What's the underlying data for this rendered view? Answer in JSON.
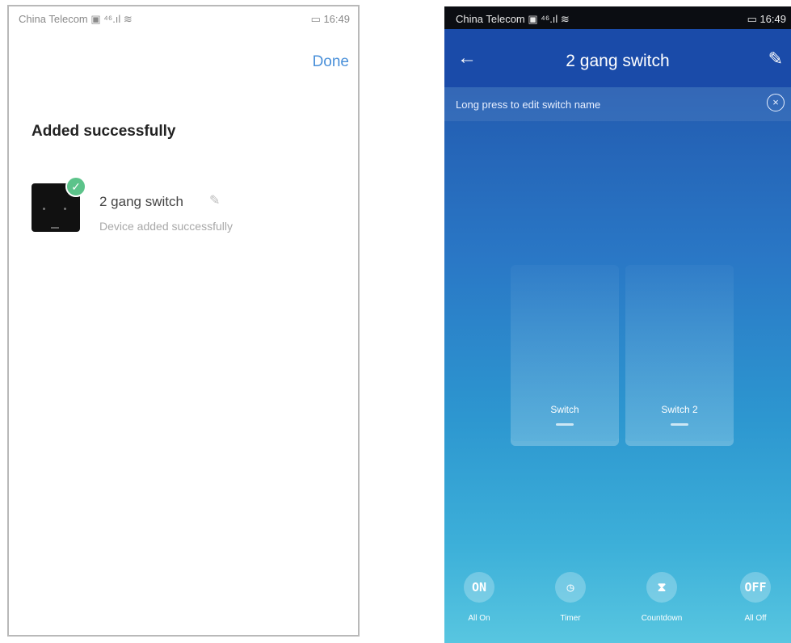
{
  "left": {
    "status": {
      "carrier": "China Telecom ▣ ⁴⁶.ıl ≋",
      "right": "▭ 16:49"
    },
    "done_label": "Done",
    "title": "Added successfully",
    "device": {
      "name": "2 gang switch",
      "status": "Device added successfully"
    }
  },
  "right": {
    "status": {
      "carrier": "China Telecom ▣ ⁴⁶.ıl ≋",
      "right": "▭ 16:49"
    },
    "title": "2 gang switch",
    "hint": "Long press to edit switch name",
    "switches": [
      {
        "label": "Switch"
      },
      {
        "label": "Switch 2"
      }
    ],
    "actions": [
      {
        "icon_text": "ON",
        "label": "All On"
      },
      {
        "icon_text": "◷",
        "label": "Timer"
      },
      {
        "icon_text": "⧗",
        "label": "Countdown"
      },
      {
        "icon_text": "OFF",
        "label": "All Off"
      }
    ]
  }
}
